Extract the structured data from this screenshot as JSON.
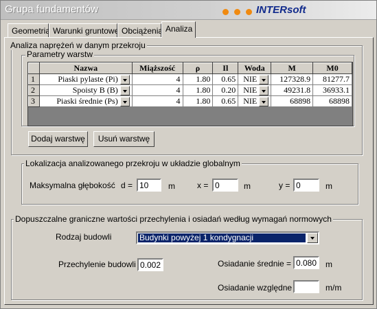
{
  "window": {
    "title": "Grupa fundamentów",
    "logo": "INTERsoft"
  },
  "tabs": [
    {
      "label": "Geometria"
    },
    {
      "label": "Warunki gruntowe"
    },
    {
      "label": "Obciążenia"
    },
    {
      "label": "Analiza",
      "active": true
    }
  ],
  "analysis": {
    "group_label": "Analiza naprężeń w danym przekroju",
    "params_label": "Parametry warstw",
    "table": {
      "headers": [
        "Nazwa",
        "Miąższość",
        "ρ",
        "Il",
        "Woda",
        "M",
        "M0"
      ],
      "rows": [
        {
          "num": "1",
          "name": "Piaski pylaste (Pi)",
          "thickness": "4",
          "rho": "1.80",
          "il": "0.65",
          "water": "NIE",
          "m": "127328.9",
          "m0": "81277.7"
        },
        {
          "num": "2",
          "name": "Spoisty B (B)",
          "thickness": "4",
          "rho": "1.80",
          "il": "0.20",
          "water": "NIE",
          "m": "49231.8",
          "m0": "36933.1"
        },
        {
          "num": "3",
          "name": "Piaski średnie (Ps)",
          "thickness": "4",
          "rho": "1.80",
          "il": "0.65",
          "water": "NIE",
          "m": "68898",
          "m0": "68898"
        }
      ]
    },
    "add_layer_button": "Dodaj warstwę",
    "remove_layer_button": "Usuń warstwę"
  },
  "localization": {
    "group_label": "Lokalizacja analizowanego przekroju w układzie globalnym",
    "max_depth_label": "Maksymalna głębokość",
    "d_label": "d =",
    "d_value": "10",
    "d_unit": "m",
    "x_label": "x =",
    "x_value": "0",
    "x_unit": "m",
    "y_label": "y =",
    "y_value": "0",
    "y_unit": "m"
  },
  "limits": {
    "group_label": "Dopuszczalne graniczne  wartości przechylenia i osiadań według wymagań normowych",
    "building_type_label": "Rodzaj budowli",
    "building_type_value": "Budynki powyżej 1 kondygnacji",
    "tilt_label": "Przechylenie budowli  =",
    "tilt_value": "0.002",
    "avg_settlement_label": "Osiadanie średnie  =",
    "avg_settlement_value": "0.080",
    "avg_settlement_unit": "m",
    "rel_settlement_label": "Osiadanie względne  =",
    "rel_settlement_value": "",
    "rel_settlement_unit": "m/m"
  }
}
